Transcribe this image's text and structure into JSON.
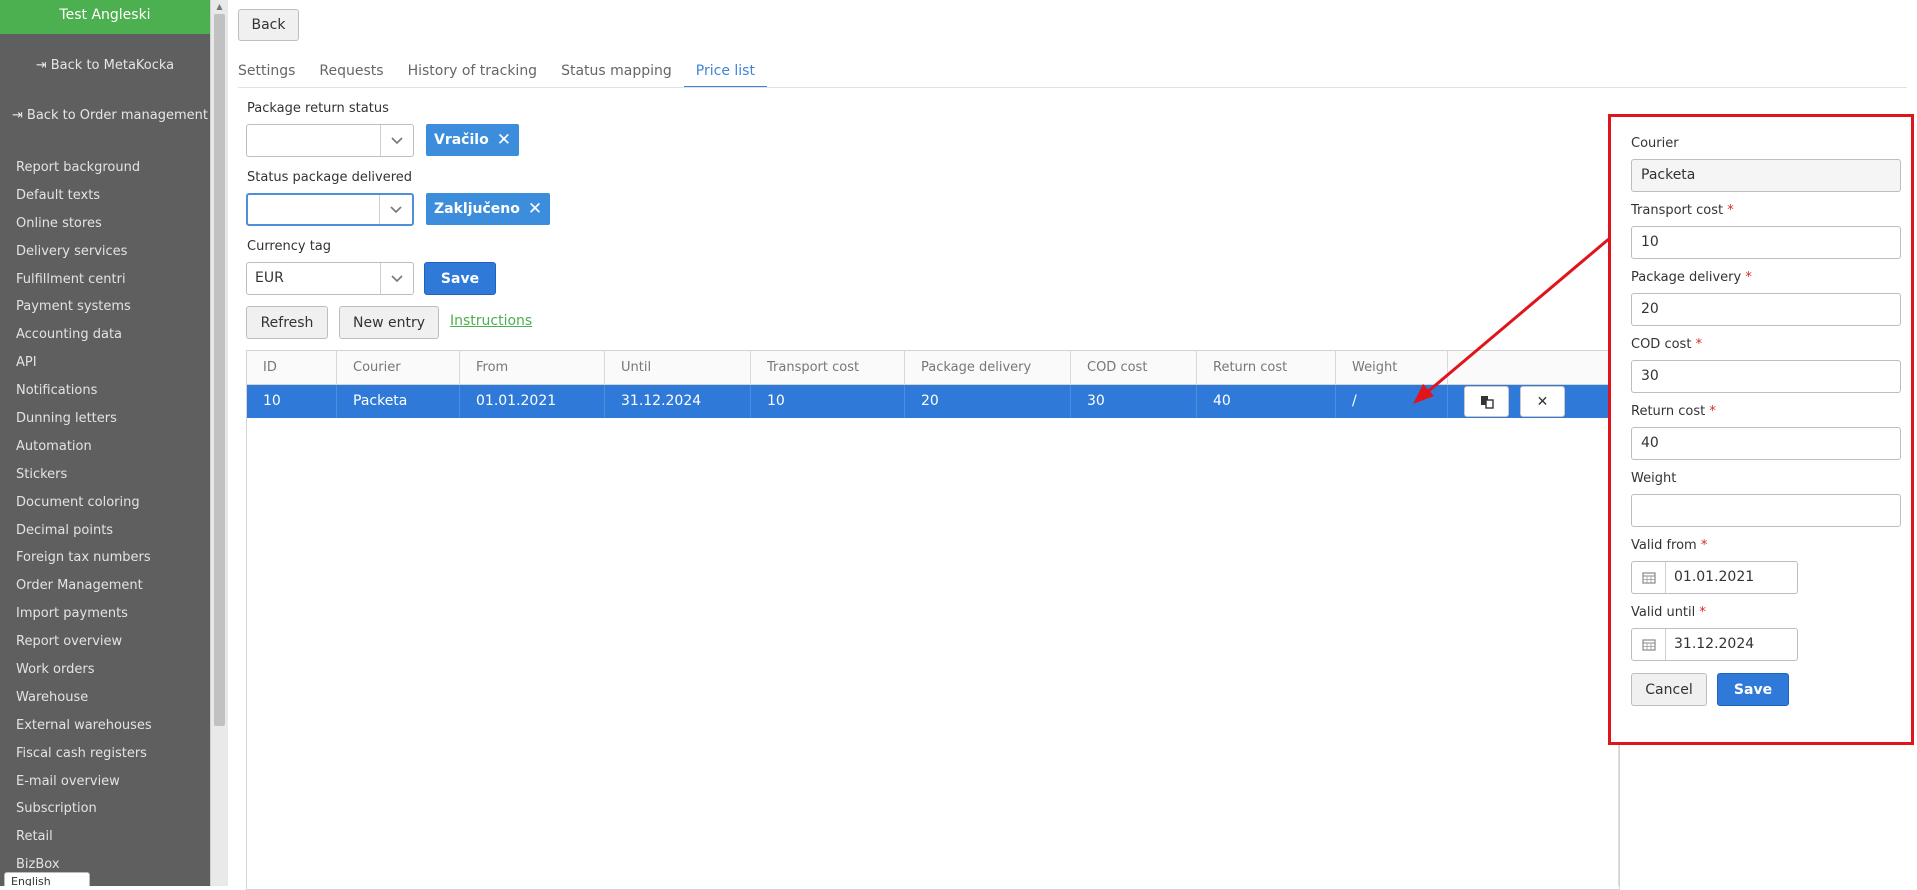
{
  "sidebar": {
    "company": "Test Angleski",
    "back_metakocka": "Back to MetaKocka",
    "back_orders": "Back to Order management",
    "items": [
      "Report background",
      "Default texts",
      "Online stores",
      "Delivery services",
      "Fulfillment centri",
      "Payment systems",
      "Accounting data",
      "API",
      "Notifications",
      "Dunning letters",
      "Automation",
      "Stickers",
      "Document coloring",
      "Decimal points",
      "Foreign tax numbers",
      "Order Management",
      "Import payments",
      "Report overview",
      "Work orders",
      "Warehouse",
      "External warehouses",
      "Fiscal cash registers",
      "E-mail overview",
      "Subscription",
      "Retail",
      "BizBox"
    ],
    "language": "English"
  },
  "toolbar": {
    "back_label": "Back"
  },
  "tabs": [
    "Settings",
    "Requests",
    "History of tracking",
    "Status mapping",
    "Price list"
  ],
  "filters": {
    "return_status_label": "Package return status",
    "return_status_value": "",
    "return_status_tag": "Vračilo",
    "delivered_label": "Status package delivered",
    "delivered_value": "",
    "delivered_tag": "Zaključeno",
    "currency_label": "Currency tag",
    "currency_value": "EUR",
    "save_label": "Save"
  },
  "actions": {
    "refresh": "Refresh",
    "new_entry": "New entry",
    "instructions": "Instructions"
  },
  "table": {
    "columns": [
      "ID",
      "Courier",
      "From",
      "Until",
      "Transport cost",
      "Package delivery",
      "COD cost",
      "Return cost",
      "Weight",
      ""
    ],
    "rows": [
      [
        "10",
        "Packeta",
        "01.01.2021",
        "31.12.2024",
        "10",
        "20",
        "30",
        "40",
        "/"
      ]
    ]
  },
  "form": {
    "courier_label": "Courier",
    "courier_value": "Packeta",
    "transport_label": "Transport cost",
    "transport_value": "10",
    "delivery_label": "Package delivery",
    "delivery_value": "20",
    "cod_label": "COD cost",
    "cod_value": "30",
    "return_label": "Return cost",
    "return_value": "40",
    "weight_label": "Weight",
    "weight_value": "",
    "from_label": "Valid from",
    "from_value": "01.01.2021",
    "until_label": "Valid until",
    "until_value": "31.12.2024",
    "cancel_label": "Cancel",
    "save_label": "Save",
    "required_mark": "*"
  },
  "colors": {
    "accent": "#2f7ad9",
    "brand": "#4caf50",
    "annotation": "#e0141b",
    "sidebar": "#5f5f5f"
  }
}
